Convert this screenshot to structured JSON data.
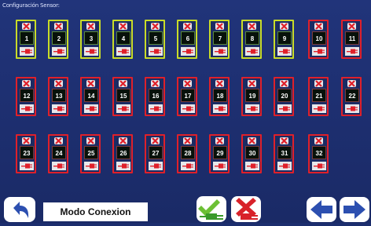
{
  "screen_title": "Configuración Sensor:",
  "mode_label": "Modo Conexion",
  "colors": {
    "active": "#c9dc28",
    "inactive": "#e0202a",
    "background": "#1c2e6e"
  },
  "sensors": [
    {
      "label": "1",
      "state": "active"
    },
    {
      "label": "2",
      "state": "active"
    },
    {
      "label": "3",
      "state": "active"
    },
    {
      "label": "4",
      "state": "active"
    },
    {
      "label": "5",
      "state": "active"
    },
    {
      "label": "6",
      "state": "active"
    },
    {
      "label": "7",
      "state": "active"
    },
    {
      "label": "8",
      "state": "active"
    },
    {
      "label": "9",
      "state": "active"
    },
    {
      "label": "10",
      "state": "inactive"
    },
    {
      "label": "11",
      "state": "inactive"
    },
    {
      "label": "12",
      "state": "inactive"
    },
    {
      "label": "13",
      "state": "inactive"
    },
    {
      "label": "14",
      "state": "inactive"
    },
    {
      "label": "15",
      "state": "inactive"
    },
    {
      "label": "16",
      "state": "inactive"
    },
    {
      "label": "17",
      "state": "inactive"
    },
    {
      "label": "18",
      "state": "inactive"
    },
    {
      "label": "19",
      "state": "inactive"
    },
    {
      "label": "20",
      "state": "inactive"
    },
    {
      "label": "21",
      "state": "inactive"
    },
    {
      "label": "22",
      "state": "inactive"
    },
    {
      "label": "23",
      "state": "inactive"
    },
    {
      "label": "24",
      "state": "inactive"
    },
    {
      "label": "25",
      "state": "inactive"
    },
    {
      "label": "26",
      "state": "inactive"
    },
    {
      "label": "27",
      "state": "inactive"
    },
    {
      "label": "28",
      "state": "inactive"
    },
    {
      "label": "29",
      "state": "inactive"
    },
    {
      "label": "30",
      "state": "inactive"
    },
    {
      "label": "31",
      "state": "inactive"
    },
    {
      "label": "32",
      "state": "inactive"
    }
  ],
  "icons": {
    "back": "back-arrow-icon",
    "connect_all": "check-plug-icon",
    "disconnect_all": "cross-plug-icon",
    "prev": "arrow-left-icon",
    "next": "arrow-right-icon"
  }
}
